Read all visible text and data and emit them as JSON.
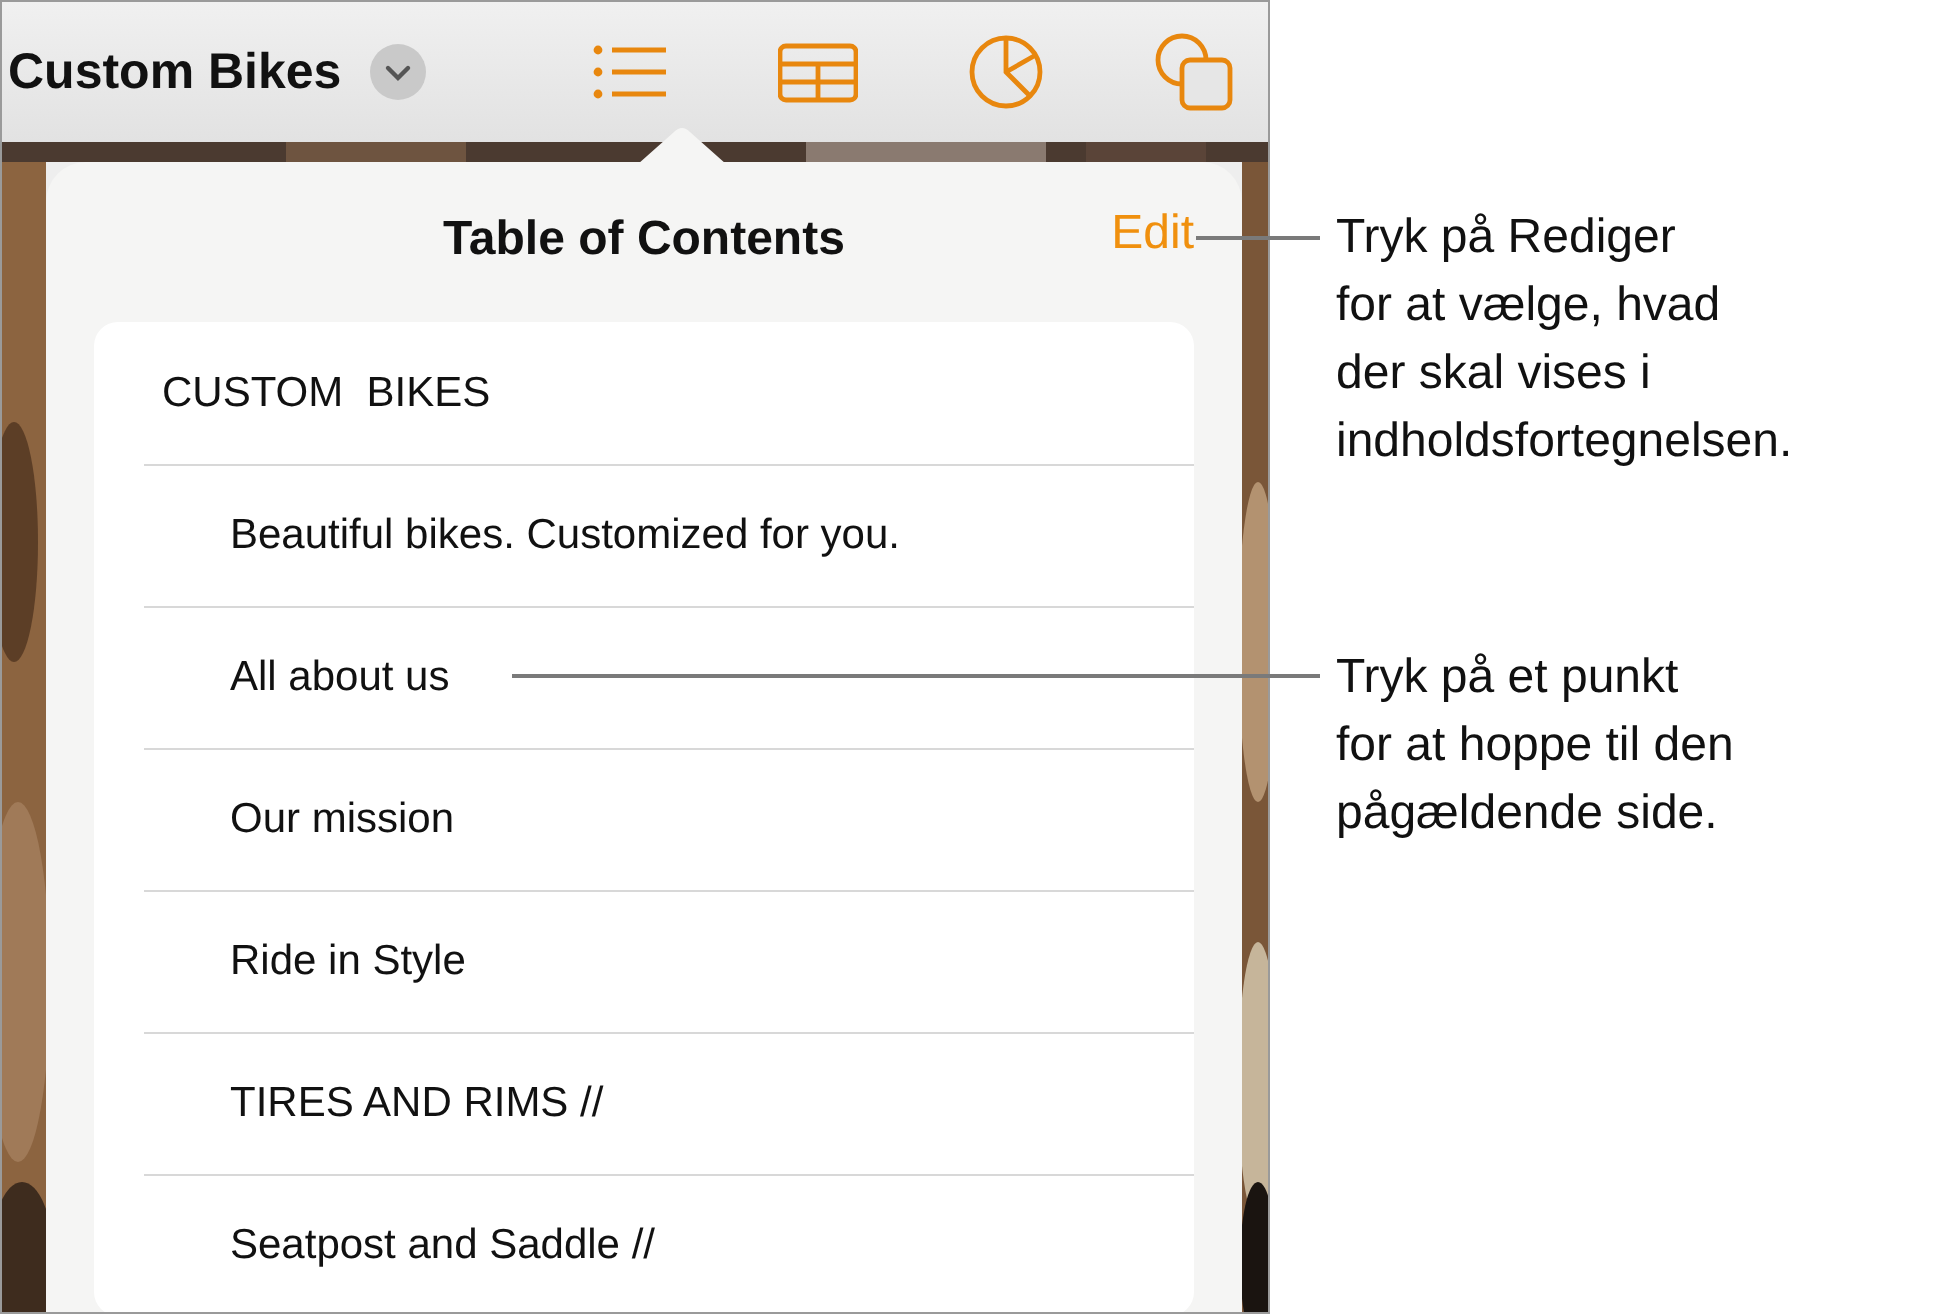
{
  "toolbar": {
    "title": "Custom Bikes"
  },
  "popover": {
    "title": "Table of Contents",
    "edit_button": "Edit",
    "items": [
      {
        "label": "CUSTOM  BIKES",
        "children": [
          {
            "label": "Beautiful bikes. Customized for you."
          },
          {
            "label": "All about us"
          },
          {
            "label": "Our mission"
          },
          {
            "label": "Ride in Style"
          },
          {
            "label": "TIRES AND RIMS //"
          },
          {
            "label": "Seatpost and Saddle //"
          }
        ]
      }
    ]
  },
  "callouts": [
    {
      "text": "Tryk på Rediger\nfor at vælge, hvad\nder skal vises i\nindholdsfortegnelsen."
    },
    {
      "text": "Tryk på et punkt\nfor at hoppe til den\npågældende side."
    }
  ]
}
